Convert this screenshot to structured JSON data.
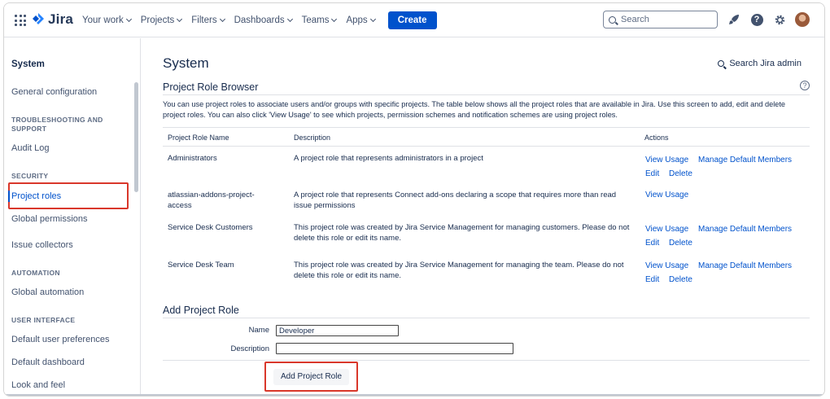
{
  "nav": {
    "brand": "Jira",
    "items": [
      "Your work",
      "Projects",
      "Filters",
      "Dashboards",
      "Teams",
      "Apps"
    ],
    "create_label": "Create",
    "search_placeholder": "Search",
    "icons": [
      "rocket-icon",
      "help-icon",
      "settings-icon",
      "avatar"
    ]
  },
  "sidebar": {
    "title": "System",
    "general": "General configuration",
    "troubleshooting_head": "TROUBLESHOOTING AND SUPPORT",
    "audit_log": "Audit Log",
    "security_head": "SECURITY",
    "project_roles": "Project roles",
    "global_permissions": "Global permissions",
    "issue_collectors": "Issue collectors",
    "automation_head": "AUTOMATION",
    "global_automation": "Global automation",
    "ui_head": "USER INTERFACE",
    "default_user_prefs": "Default user preferences",
    "default_dashboard": "Default dashboard",
    "look_and_feel": "Look and feel"
  },
  "main": {
    "title": "System",
    "admin_search": "Search Jira admin",
    "section_title": "Project Role Browser",
    "help_glyph": "?",
    "intro": "You can use project roles to associate users and/or groups with specific projects. The table below shows all the project roles that are available in Jira. Use this screen to add, edit and delete project roles. You can also click 'View Usage' to see which projects, permission schemes and notification schemes are using project roles.",
    "table": {
      "headers": [
        "Project Role Name",
        "Description",
        "Actions"
      ],
      "rows": [
        {
          "name": "Administrators",
          "description": "A project role that represents administrators in a project",
          "view_usage": "View Usage",
          "manage": "Manage Default Members",
          "edit": "Edit",
          "delete": "Delete"
        },
        {
          "name": "atlassian-addons-project-access",
          "description": "A project role that represents Connect add-ons declaring a scope that requires more than read issue permissions",
          "view_usage": "View Usage"
        },
        {
          "name": "Service Desk Customers",
          "description": "This project role was created by Jira Service Management for managing customers. Please do not delete this role or edit its name.",
          "view_usage": "View Usage",
          "manage": "Manage Default Members",
          "edit": "Edit",
          "delete": "Delete"
        },
        {
          "name": "Service Desk Team",
          "description": "This project role was created by Jira Service Management for managing the team. Please do not delete this role or edit its name.",
          "view_usage": "View Usage",
          "manage": "Manage Default Members",
          "edit": "Edit",
          "delete": "Delete"
        }
      ]
    },
    "add_role": {
      "title": "Add Project Role",
      "name_label": "Name",
      "name_value": "Developer",
      "description_label": "Description",
      "description_value": "",
      "button_label": "Add Project Role"
    }
  },
  "colors": {
    "brand_blue": "#0052cc",
    "highlight_red": "#d9372b"
  }
}
